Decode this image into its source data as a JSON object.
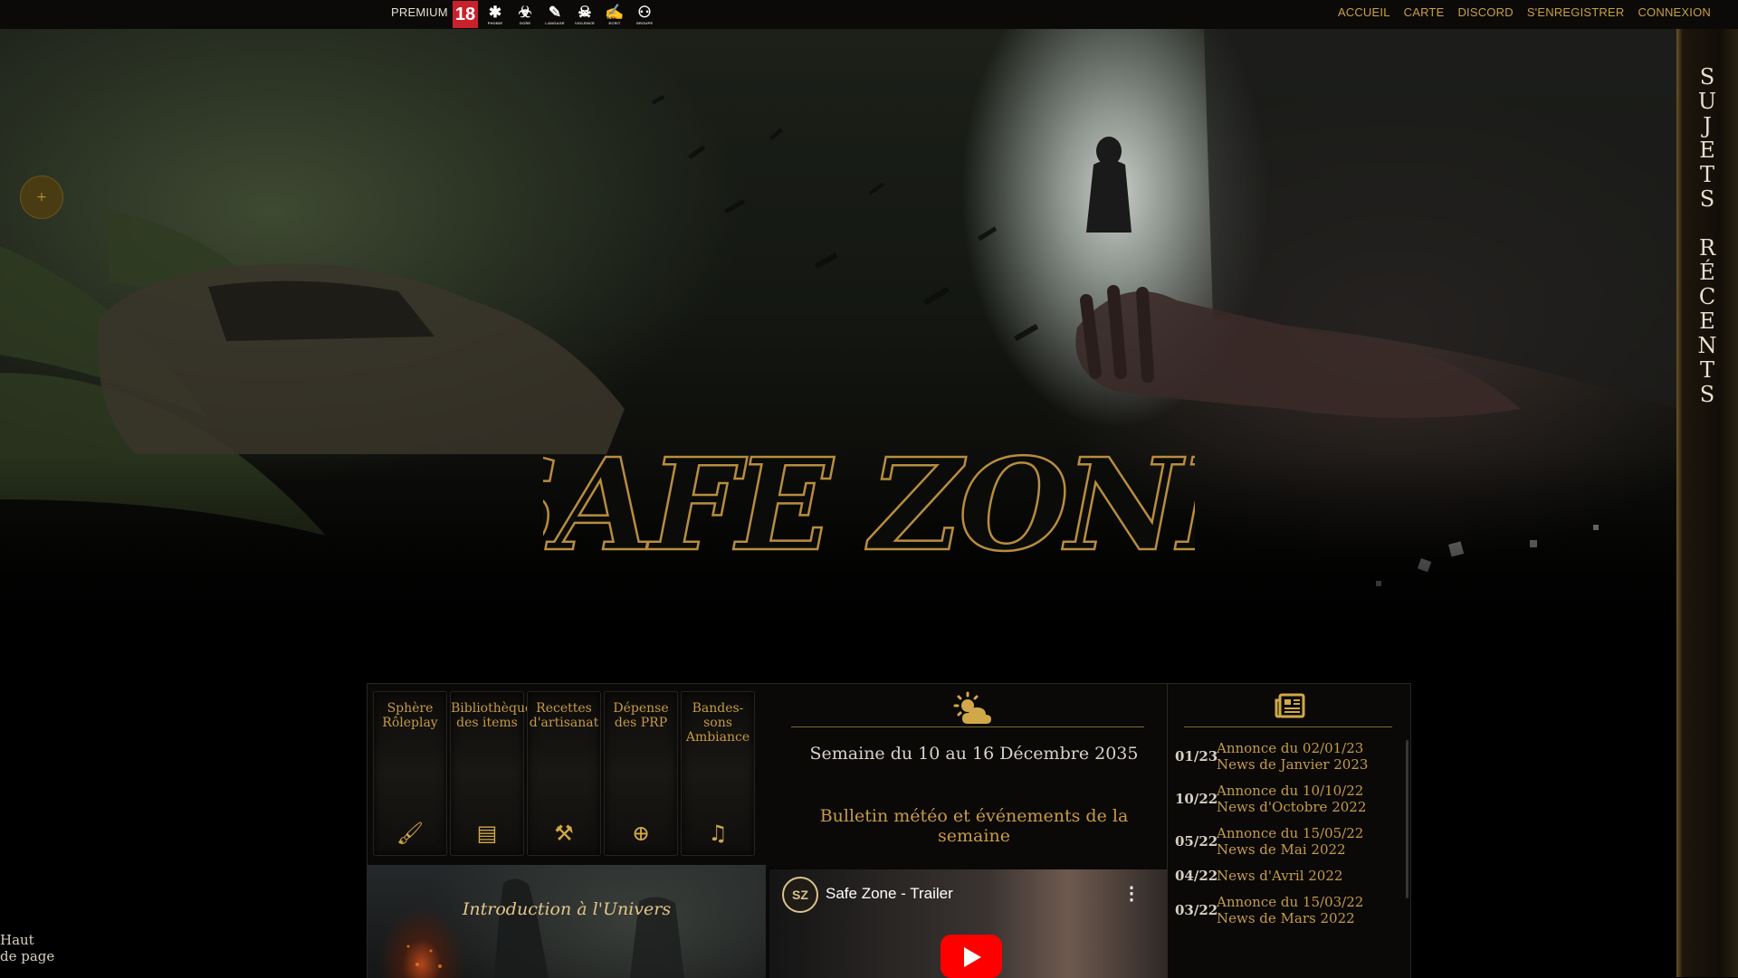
{
  "topbar": {
    "premium_label": "PREMIUM",
    "age_badge": "18",
    "content_badges": [
      "spider-icon",
      "gore-icon",
      "speech-icon",
      "violence-icon",
      "writing-icon",
      "group-icon"
    ],
    "nav": [
      "ACCUEIL",
      "CARTE",
      "DISCORD",
      "S'ENREGISTRER",
      "CONNEXION"
    ]
  },
  "hero": {
    "logo_text": "SAFE ZONE",
    "plus_label": "+"
  },
  "rail": {
    "title_lines": [
      "S",
      "U",
      "J",
      "E",
      "T",
      "S",
      "",
      "R",
      "É",
      "C",
      "E",
      "N",
      "T",
      "S"
    ]
  },
  "back_to_top": {
    "line1": "Haut",
    "line2": "de page"
  },
  "tabs": [
    {
      "label": "Sphère Rôleplay",
      "icon": "brush-icon"
    },
    {
      "label": "Bibliothèque des items",
      "icon": "book-icon"
    },
    {
      "label": "Recettes d'artisanat",
      "icon": "tools-icon"
    },
    {
      "label": "Dépense des PRP",
      "icon": "plus-circle-icon"
    },
    {
      "label": "Bandes-sons Ambiance",
      "icon": "music-icon"
    }
  ],
  "weather": {
    "icon": "sun-cloud-icon",
    "week": "Semaine du 10 au 16 Décembre 2035",
    "bulletin": "Bulletin météo et événements de la semaine"
  },
  "news": {
    "icon": "newspaper-icon",
    "items": [
      {
        "date": "01/23",
        "lines": [
          "Annonce du 02/01/23",
          "News de Janvier 2023"
        ]
      },
      {
        "date": "10/22",
        "lines": [
          "Annonce du 10/10/22",
          "News d'Octobre 2022"
        ]
      },
      {
        "date": "05/22",
        "lines": [
          "Annonce du 15/05/22",
          "News de Mai 2022"
        ]
      },
      {
        "date": "04/22",
        "lines": [
          "News d'Avril 2022"
        ]
      },
      {
        "date": "03/22",
        "lines": [
          "Annonce du 15/03/22",
          "News de Mars 2022"
        ]
      }
    ]
  },
  "intro": {
    "title": "Introduction à l'Univers"
  },
  "video": {
    "channel_initials": "SZ",
    "title": "Safe Zone - Trailer"
  },
  "colors": {
    "accent": "#c99a46",
    "text": "#d6cfc0",
    "bg": "#000000"
  }
}
